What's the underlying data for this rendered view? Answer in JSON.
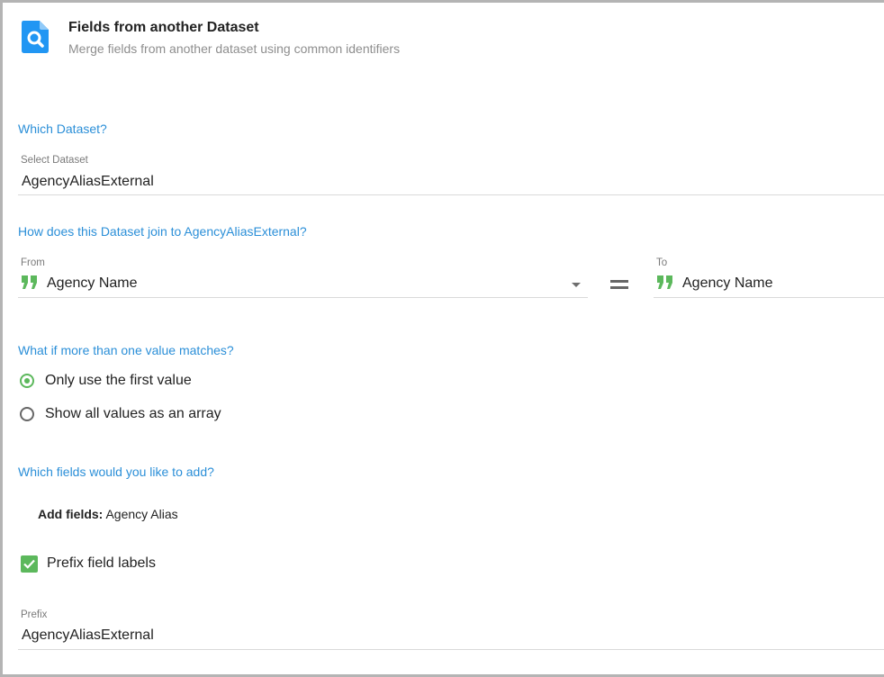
{
  "header": {
    "title": "Fields from another Dataset",
    "subtitle": "Merge fields from another dataset using common identifiers",
    "icon": "dataset-search-icon"
  },
  "dataset_section": {
    "heading": "Which Dataset?",
    "select_label": "Select Dataset",
    "select_value": "AgencyAliasExternal"
  },
  "join_section": {
    "heading": "How does this Dataset join to AgencyAliasExternal?",
    "from_label": "From",
    "from_value": "Agency Name",
    "to_label": "To",
    "to_value": "Agency Name",
    "field_type_icon": "text-quote-icon",
    "accent_color": "#5cb85c"
  },
  "match_section": {
    "heading": "What if more than one value matches?",
    "options": [
      {
        "label": "Only use the first value",
        "checked": true
      },
      {
        "label": "Show all values as an array",
        "checked": false
      }
    ]
  },
  "fields_section": {
    "heading": "Which fields would you like to add?",
    "add_fields_label": "Add fields:",
    "add_fields_value": "Agency Alias",
    "prefix_checkbox_label": "Prefix field labels",
    "prefix_checked": true,
    "prefix_label": "Prefix",
    "prefix_value": "AgencyAliasExternal"
  },
  "colors": {
    "section_heading": "#2b8fd8",
    "icon_blue": "#2196f3",
    "check_green": "#5cb85c"
  }
}
